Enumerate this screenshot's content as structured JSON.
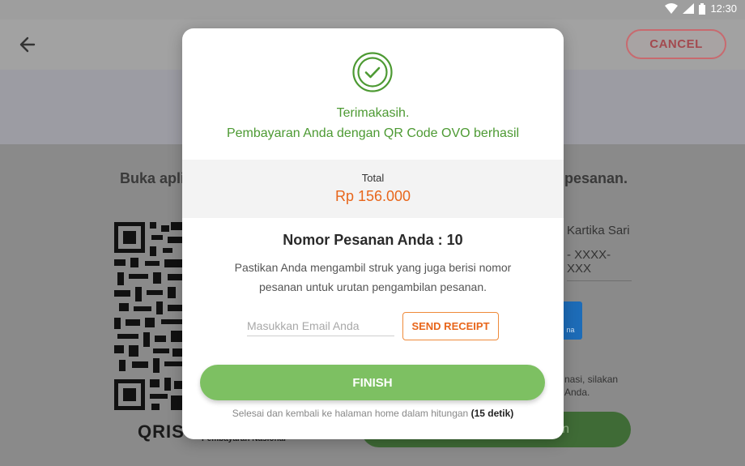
{
  "status_bar": {
    "time": "12:30",
    "icons": [
      "wifi-icon",
      "signal-icon",
      "battery-icon"
    ]
  },
  "app_bar": {
    "back_icon": "arrow-left-icon",
    "cancel_label": "CANCEL"
  },
  "background": {
    "instruction_left": "Buka apli",
    "instruction_right": "pesanan.",
    "merchant_name": "Kartika Sari",
    "phone_masked": "- XXXX-XXX",
    "logo_text": "na",
    "info_text": "nasi, silakan Anda.",
    "qris_brand": "QRIS",
    "qris_sub": "Pembayaran Nasional",
    "green_button_label": "n"
  },
  "modal": {
    "icon": "check-circle-icon",
    "thanks_line1": "Terimakasih.",
    "thanks_line2": "Pembayaran Anda dengan QR Code OVO berhasil",
    "total_label": "Total",
    "total_value": "Rp 156.000",
    "order_number": "Nomor Pesanan Anda : 10",
    "order_description": "Pastikan Anda mengambil struk yang juga berisi nomor pesanan untuk urutan pengambilan pesanan.",
    "email_placeholder": "Masukkan Email Anda",
    "email_value": "",
    "send_receipt_label": "SEND RECEIPT",
    "finish_label": "FINISH",
    "footer_text": "Selesai dan kembali ke halaman home dalam hitungan",
    "footer_countdown": "(15 detik)"
  },
  "colors": {
    "success_green": "#4d9a33",
    "finish_green": "#7dc062",
    "total_orange": "#e8661b",
    "cancel_red": "#c86a6f"
  }
}
